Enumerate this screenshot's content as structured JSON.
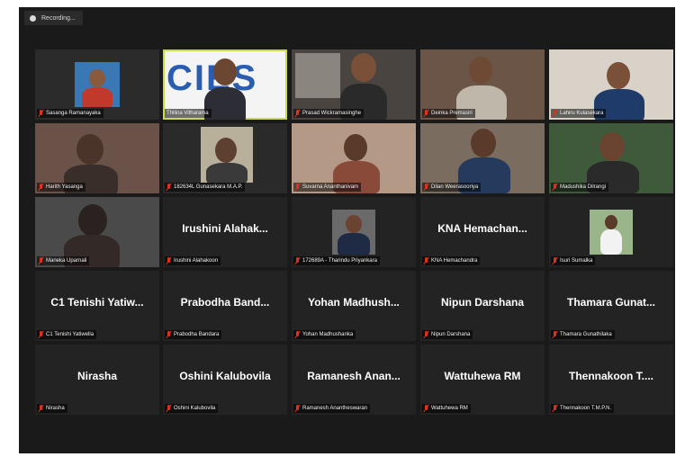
{
  "recording": {
    "label": "Recording..."
  },
  "tiles": [
    {
      "name": "Sasanga Ramanayaka",
      "mode": "photo"
    },
    {
      "name": "Thilina Vitharama",
      "mode": "video",
      "logo": "CIES"
    },
    {
      "name": "Prasad Wickramasinghe",
      "mode": "video"
    },
    {
      "name": "Deinka Premasiri",
      "mode": "video"
    },
    {
      "name": "Lahiru Kulasekara",
      "mode": "video"
    },
    {
      "name": "Harith Yasanga",
      "mode": "video"
    },
    {
      "name": "182634L Gunasekara M.A.P.",
      "mode": "video"
    },
    {
      "name": "Suvarna Ananthanivam",
      "mode": "video"
    },
    {
      "name": "Dilan Weerasooriya",
      "mode": "video"
    },
    {
      "name": "Madushika Dilrangi",
      "mode": "video"
    },
    {
      "name": "Maneka Uparnali",
      "mode": "video"
    },
    {
      "name": "Irushini Alahakoon",
      "mode": "name",
      "display": "Irushini Alahak..."
    },
    {
      "name": "172689A - Tharindu Priyankara",
      "mode": "photo"
    },
    {
      "name": "KNA Hemachandra",
      "mode": "name",
      "display": "KNA Hemachan..."
    },
    {
      "name": "Isuri Sumalka",
      "mode": "photo"
    },
    {
      "name": "C1 Tenishi Yatiwella",
      "mode": "name",
      "display": "C1 Tenishi Yatiw..."
    },
    {
      "name": "Prabodha Bandara",
      "mode": "name",
      "display": "Prabodha Band..."
    },
    {
      "name": "Yohan Madhushanka",
      "mode": "name",
      "display": "Yohan Madhush..."
    },
    {
      "name": "Nipun Darshana",
      "mode": "name",
      "display": "Nipun Darshana"
    },
    {
      "name": "Thamara Gunathilaka",
      "mode": "name",
      "display": "Thamara Gunat..."
    },
    {
      "name": "Nirasha",
      "mode": "name",
      "display": "Nirasha"
    },
    {
      "name": "Oshini Kalubovila",
      "mode": "name",
      "display": "Oshini Kalubovila"
    },
    {
      "name": "Ramanesh Anantheswaran",
      "mode": "name",
      "display": "Ramanesh Anan..."
    },
    {
      "name": "Wattuhewa RM",
      "mode": "name",
      "display": "Wattuhewa RM"
    },
    {
      "name": "Thennakoon T.M.P.N.",
      "mode": "name",
      "display": "Thennakoon T...."
    }
  ],
  "colors": {
    "background": "#1a1a1a",
    "tile": "#232323",
    "active_outline": "#c9d94a",
    "mute": "#e0301e"
  },
  "icons": {
    "mute": "mic-muted-icon",
    "recording": "recording-dot-icon"
  }
}
